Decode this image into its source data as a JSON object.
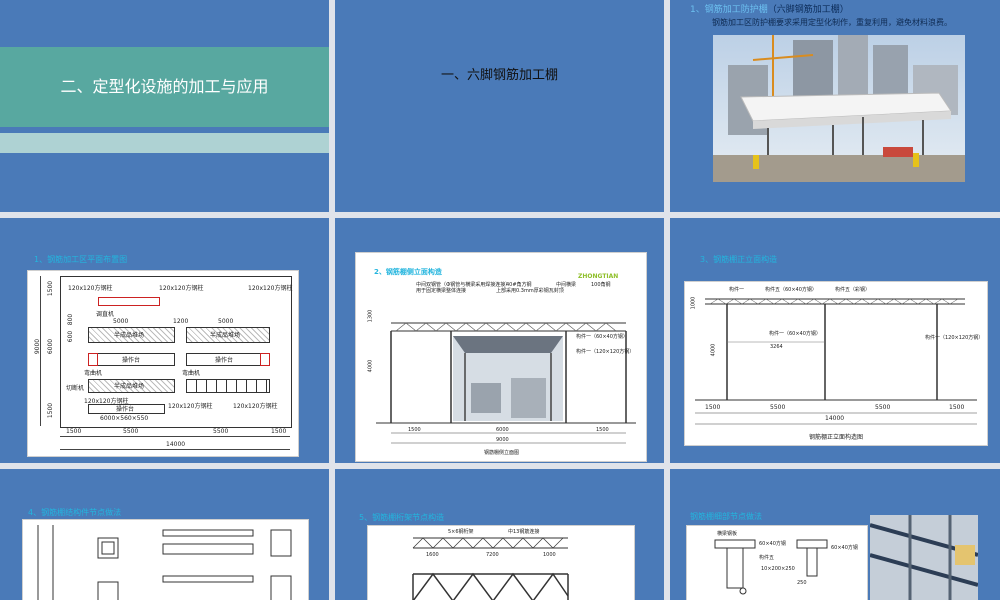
{
  "slides": {
    "s1": {
      "title": "二、定型化设施的加工与应用"
    },
    "s2": {
      "title": "一、六脚钢筋加工棚"
    },
    "s3": {
      "heading_prefix": "1、钢筋加工防护棚",
      "heading_suffix": "（六脚钢筋加工棚）",
      "description": "钢筋加工区防护棚要求采用定型化制作，重复利用，避免材料浪费。"
    },
    "s4": {
      "section_title": "1、钢筋加工区平面布置图",
      "labels": {
        "steel_col_tl": "120x120方钢柱",
        "steel_col_tc": "120x120方钢柱",
        "steel_col_tr": "120x120方钢柱",
        "steel_col_bl": "120x120方钢柱",
        "steel_col_bc": "120x120方钢柱",
        "steel_col_br": "120x120方钢柱",
        "straightener": "调直机",
        "semi_area_1": "半成品堆场",
        "semi_area_2": "半成品堆场",
        "semi_area_3": "半成品堆场",
        "op_table_1": "操作台",
        "op_table_2": "操作台",
        "op_table_3": "操作台",
        "bender_1": "弯曲机",
        "bender_2": "弯曲机",
        "cutter": "切断机",
        "table_dims": "6000×560×550",
        "dim_5000_a": "5000",
        "dim_5000_b": "5000",
        "dim_1200": "1200",
        "dim_9000": "9000",
        "dim_6000": "6000",
        "dim_1500_t": "1500",
        "dim_1500_b": "1500",
        "dim_800": "800",
        "dim_600": "600",
        "dim_bottom_1500a": "1500",
        "dim_bottom_5500a": "5500",
        "dim_bottom_5500b": "5500",
        "dim_bottom_1500b": "1500",
        "dim_total": "14000"
      }
    },
    "s5": {
      "section_title": "2、钢筋棚侧立面构造",
      "logo_text": "ZHONGTIAN",
      "caption": "钢筋棚侧立面图",
      "notes": [
        "中间双钢管（Ф钢管与横梁采用焊接连接）",
        "用于固定横梁整体连接",
        "40#角方钢",
        "上部采用0.3mm厚彩钢瓦封顶",
        "中间横梁",
        "100角钢",
        "构件一（60×40方钢）",
        "构件一（120×120方钢）"
      ],
      "dims": {
        "a": "1500",
        "b": "6000",
        "c": "1500",
        "total": "9000",
        "h": "4000",
        "top": "1300"
      }
    },
    "s6": {
      "section_title": "3、钢筋棚正立面构造",
      "caption": "钢筋棚正立面构造图",
      "labels": {
        "part_a": "构件一",
        "part_b": "构件五（60×40方钢）",
        "part_c": "构件五（彩钢）",
        "part_d": "构件一（60×40方钢）",
        "part_e": "构件一（120×120方钢）",
        "span": "3264",
        "h": "4000",
        "top": "1000"
      },
      "dims": {
        "a": "1500",
        "b": "5500",
        "c": "5500",
        "d": "1500",
        "total": "14000"
      }
    },
    "s7": {
      "section_title": "4、钢筋棚结构件节点做法"
    },
    "s8": {
      "section_title": "5、钢筋棚桁架节点构造",
      "labels": {
        "a": "5×6钢桁架",
        "b": "中13钢筋连接",
        "c": "1600",
        "d": "7200",
        "e": "1000"
      }
    },
    "s9": {
      "section_title": "钢筋棚细部节点做法",
      "labels": {
        "a": "横梁钢板",
        "b": "60×40方钢",
        "c": "60×40方钢",
        "d": "构件五",
        "e": "250",
        "f": "10×200×250"
      }
    }
  },
  "colors": {
    "slide_bg": "#4a7ab8",
    "teal": "#58a8a0",
    "accent_cyan": "#23b5de",
    "page_bg": "#dfe3ea"
  }
}
